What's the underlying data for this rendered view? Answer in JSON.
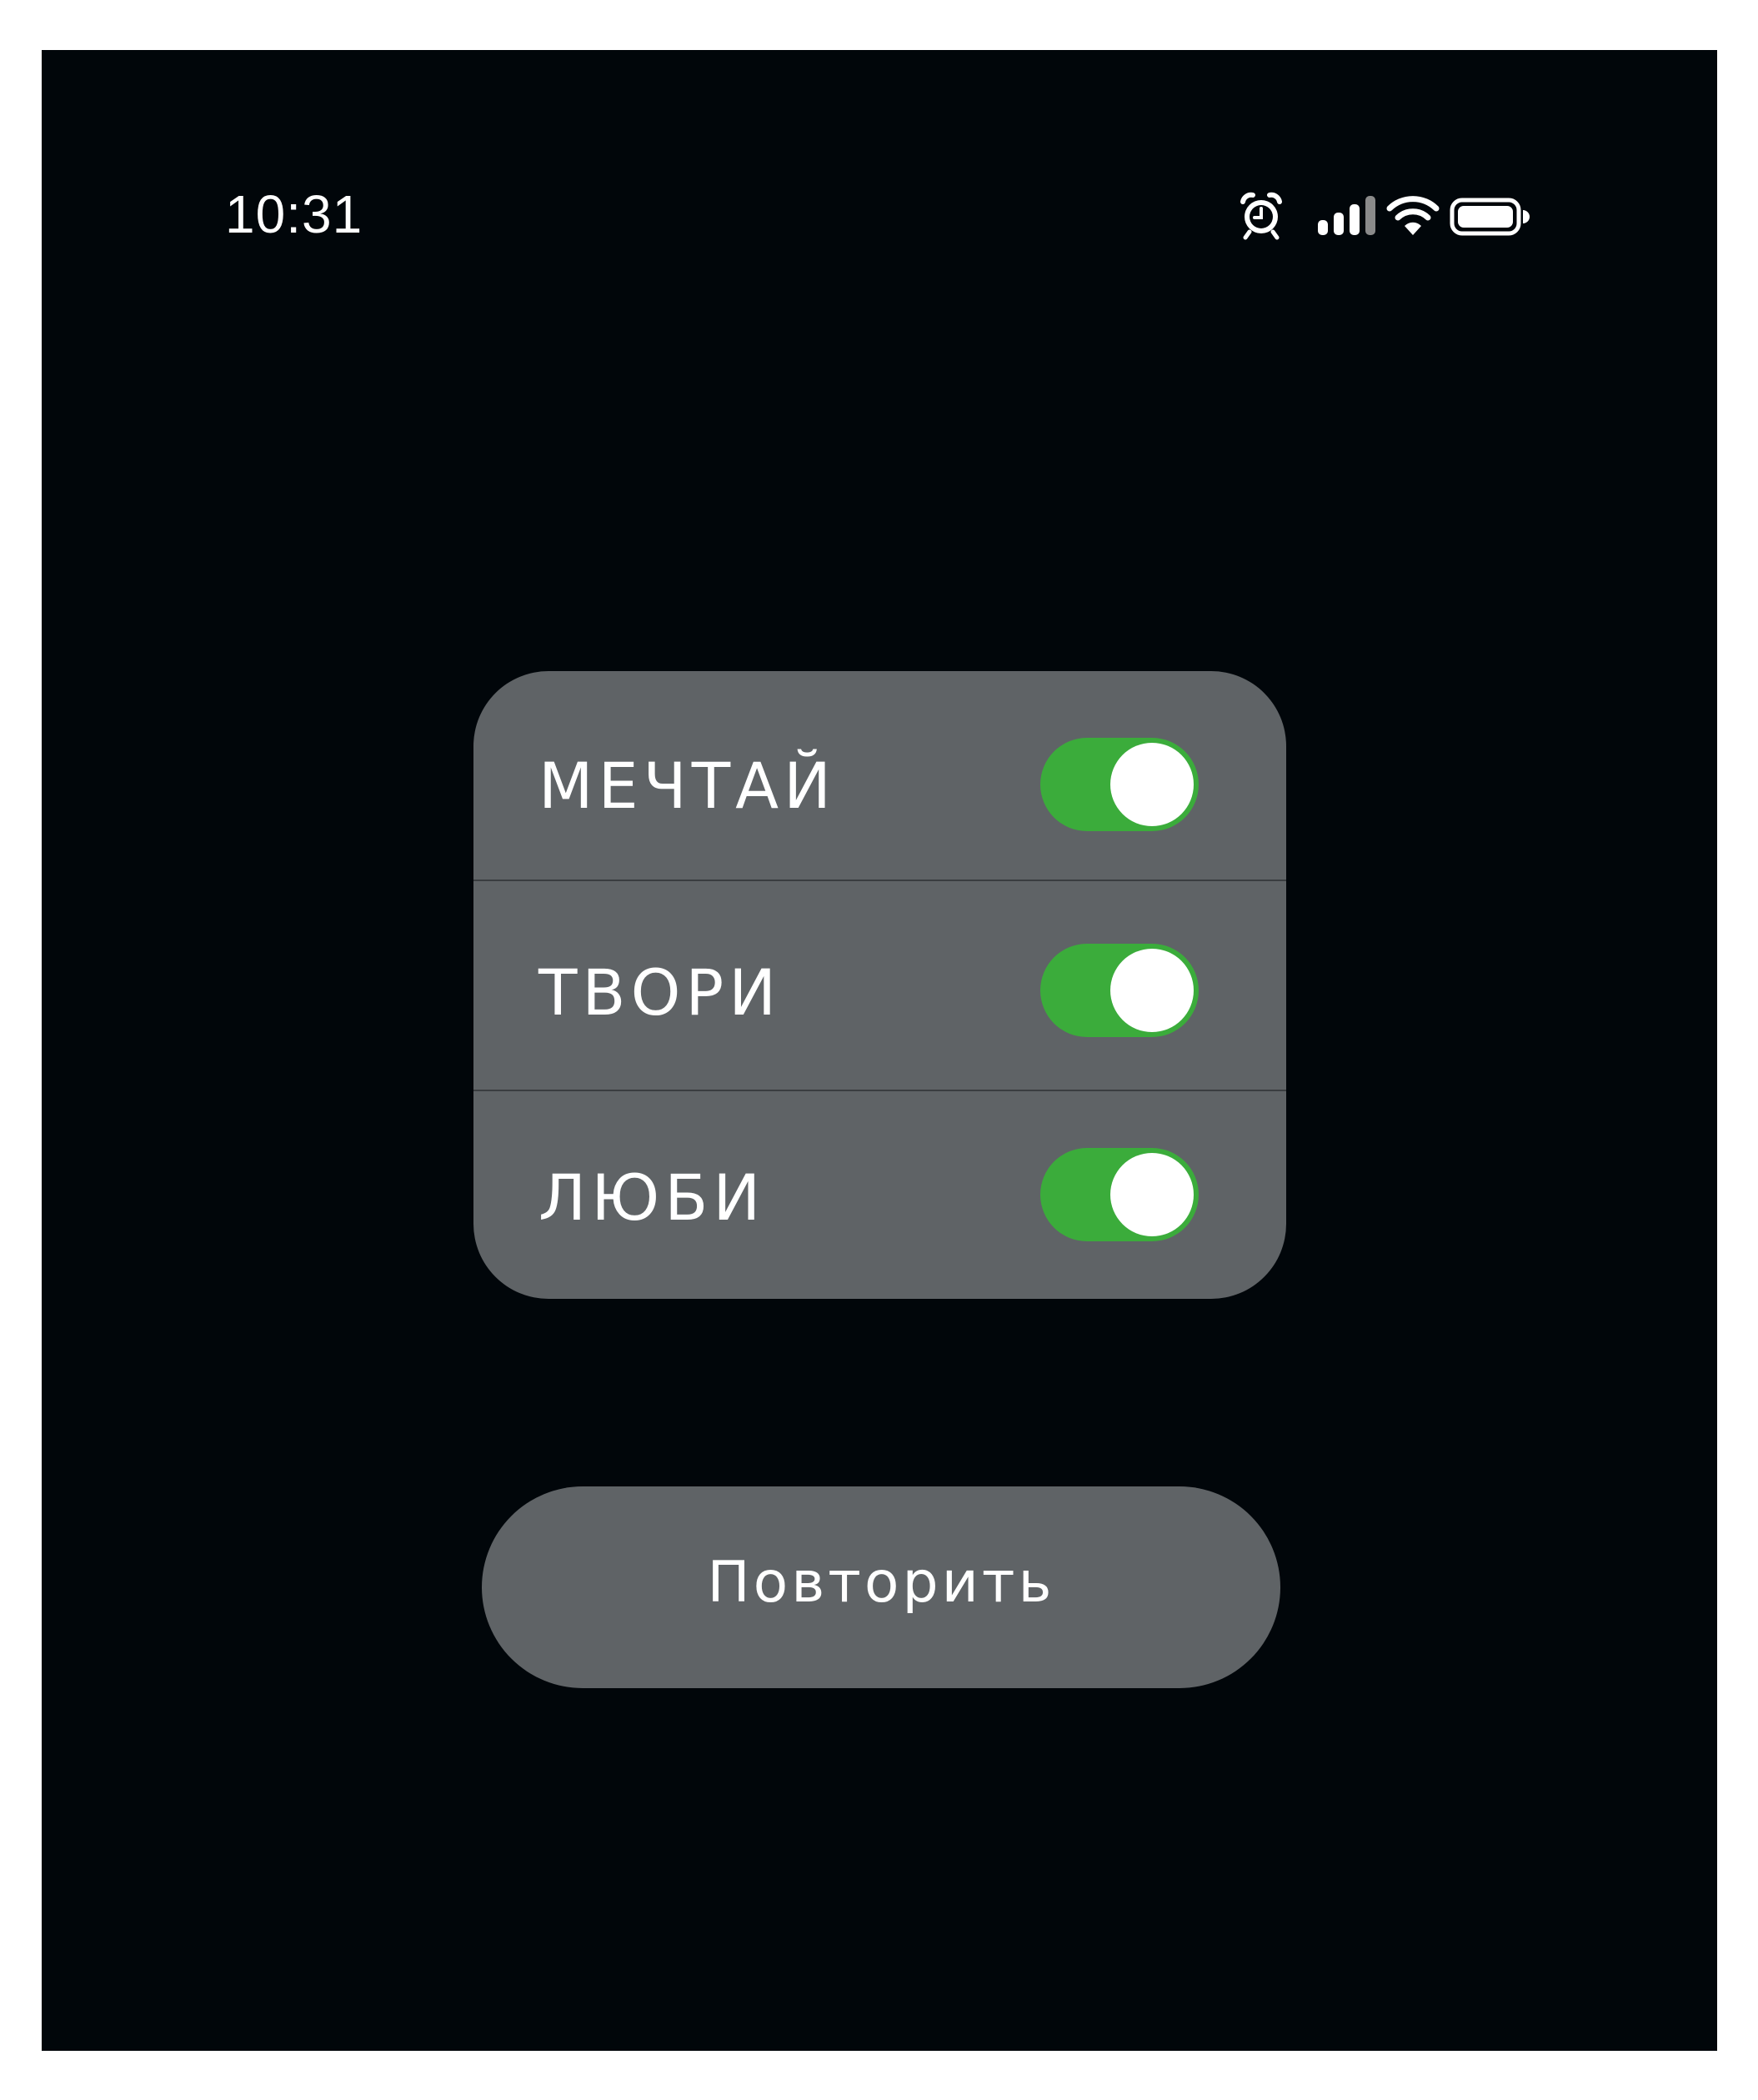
{
  "status_bar": {
    "time": "10:31",
    "icons": [
      "alarm-icon",
      "cellular-signal-icon",
      "wifi-icon",
      "battery-icon"
    ]
  },
  "toggles": [
    {
      "label": "МЕЧТАЙ",
      "on": true
    },
    {
      "label": "ТВОРИ",
      "on": true
    },
    {
      "label": "ЛЮБИ",
      "on": true
    }
  ],
  "repeat_button": {
    "label": "Повторить"
  },
  "colors": {
    "background": "#01060a",
    "card": "#5f6366",
    "toggle_on": "#3bac3b",
    "text": "#ffffff"
  }
}
